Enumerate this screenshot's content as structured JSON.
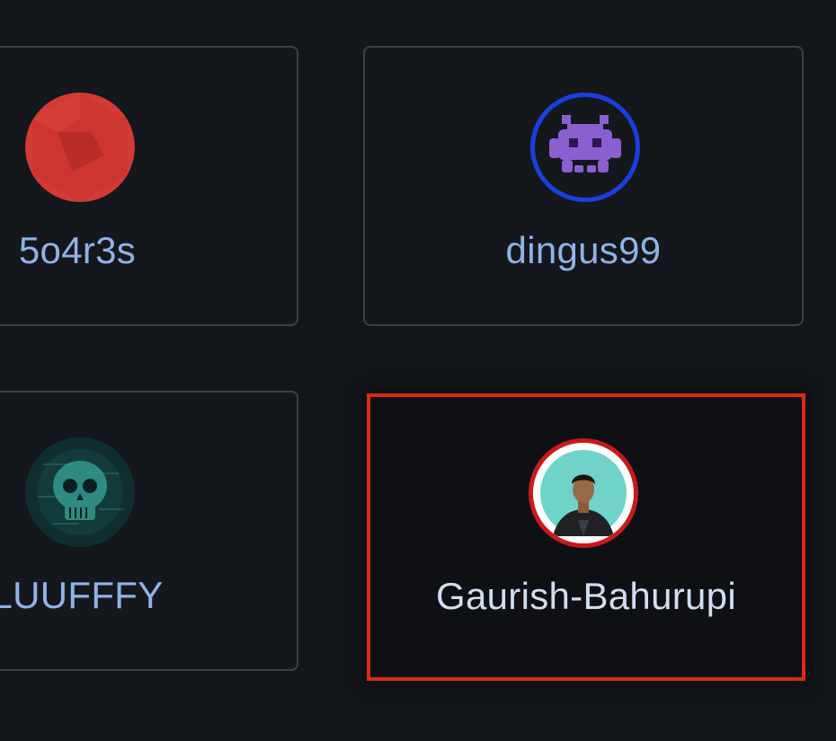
{
  "colors": {
    "background": "#13161b",
    "link": "#8fb3e6",
    "name_highlight": "#d2ddf0",
    "highlight_border": "#e02a10",
    "ring_blue": "#1a3fe0",
    "ring_red": "#c91a1a"
  },
  "users": [
    {
      "login": "5o4r3s",
      "avatar_icon": "red-hexagon-avatar-icon"
    },
    {
      "login": "dingus99",
      "avatar_icon": "space-invader-icon"
    },
    {
      "login": "LUUFFFY",
      "avatar_icon": "glitch-skull-icon"
    },
    {
      "login": "Gaurish-Bahurupi",
      "avatar_icon": "profile-photo-icon"
    }
  ]
}
